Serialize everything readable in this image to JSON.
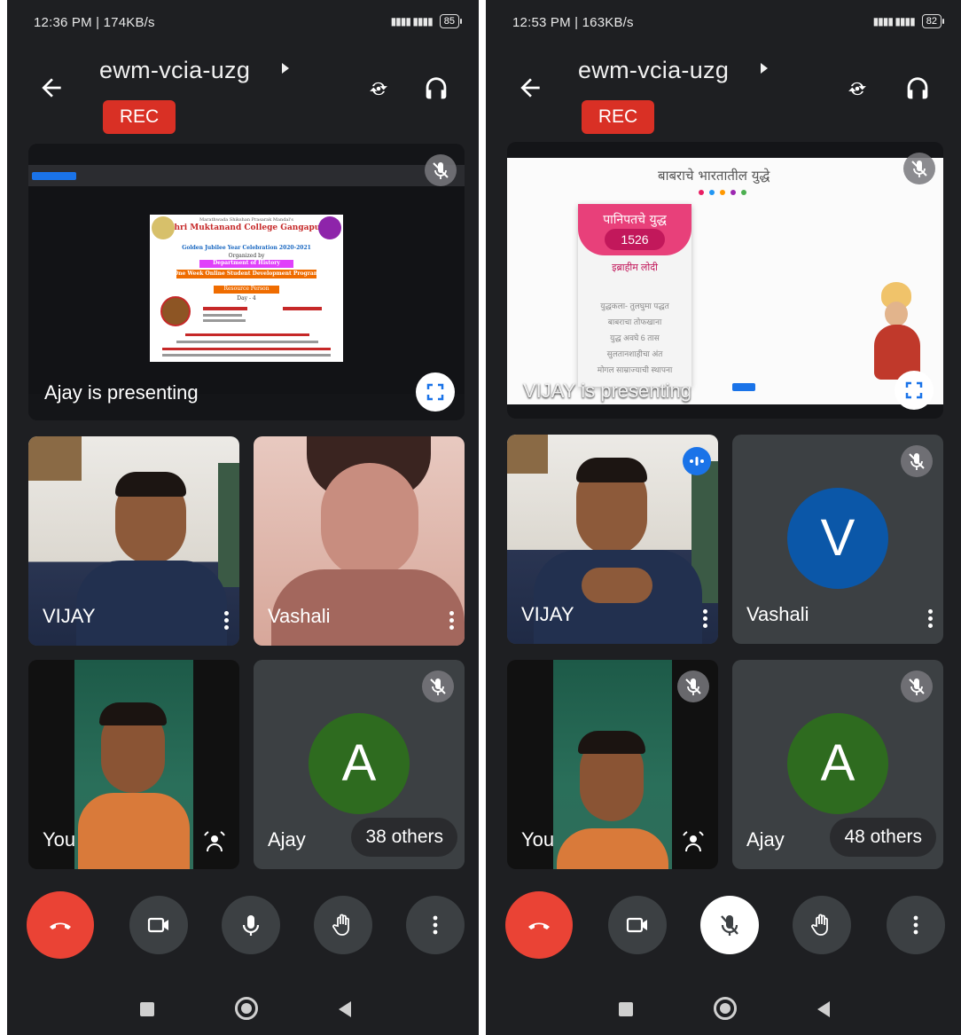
{
  "screens": [
    {
      "status": {
        "time": "12:36 PM | 174KB/s",
        "signal": "4G",
        "battery": "85"
      },
      "meeting": {
        "title": "ewm-vcia-uzg",
        "rec": "REC"
      },
      "presentation": {
        "label": "Ajay is presenting",
        "poster": {
          "org": "Marathwada Shikshan Prasarak Mandal's",
          "college": "Shri Muktanand College Gangapur",
          "event": "Golden Jubilee Year Celebration 2020-2021",
          "organized_by": "Organized by",
          "department": "Department of History",
          "program": "One Week Online Student Development Program",
          "resource": "Resource Person",
          "day": "Day - 4"
        }
      },
      "tiles": [
        {
          "name": "VIJAY"
        },
        {
          "name": "Vashali"
        },
        {
          "name": "You"
        },
        {
          "name": "Ajay",
          "avatar_letter": "A",
          "others": "38 others"
        }
      ]
    },
    {
      "status": {
        "time": "12:53 PM | 163KB/s",
        "signal": "4G",
        "battery": "82"
      },
      "meeting": {
        "title": "ewm-vcia-uzg",
        "rec": "REC"
      },
      "presentation": {
        "label": "VIJAY is presenting",
        "slide": {
          "title": "बाबराचे भारतातील युद्धे",
          "card_title": "पानिपतचे युद्ध",
          "year": "1526",
          "opponent": "इब्राहीम लोदी",
          "lines": [
            "युद्धकला- तुलघुमा पद्धत",
            "बाबराचा तोफखाना",
            "युद्ध अवघे 6 तास",
            "सुलतानशाहीचा अंत",
            "मोगल साम्राज्याची स्थापना"
          ]
        }
      },
      "tiles": [
        {
          "name": "VIJAY"
        },
        {
          "name": "Vashali",
          "avatar_letter": "V"
        },
        {
          "name": "You"
        },
        {
          "name": "Ajay",
          "avatar_letter": "A",
          "others": "48 others"
        }
      ]
    }
  ],
  "colors": {
    "end_call": "#ea4335",
    "rec": "#d93025",
    "avatar_a": "#2e6b1f",
    "avatar_v": "#0b57a8"
  },
  "icons": [
    "back-arrow-icon",
    "switch-camera-icon",
    "headphones-icon",
    "mic-off-icon",
    "expand-icon",
    "more-vert-icon",
    "end-call-icon",
    "camera-icon",
    "mic-icon",
    "raise-hand-icon",
    "noise-icon"
  ]
}
